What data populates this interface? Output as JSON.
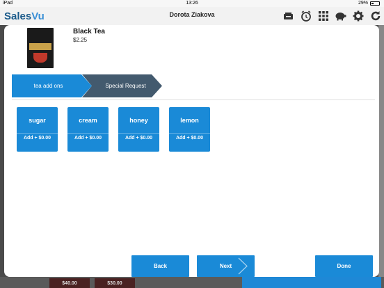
{
  "status": {
    "device": "iPad",
    "time": "13:26",
    "battery": "29%"
  },
  "header": {
    "logo_sales": "Sales",
    "logo_vu": "Vu",
    "user": "Dorota Ziakova",
    "icons": [
      "register-icon",
      "alarm-clock-icon",
      "grid-icon",
      "piggy-bank-icon",
      "gear-icon",
      "refresh-icon"
    ]
  },
  "product": {
    "name": "Black Tea",
    "price": "$2.25"
  },
  "steps": [
    {
      "label": "tea add ons",
      "active": true
    },
    {
      "label": "Special Request",
      "active": false
    }
  ],
  "addons": [
    {
      "name": "sugar",
      "price": "Add + $0.00"
    },
    {
      "name": "cream",
      "price": "Add + $0.00"
    },
    {
      "name": "honey",
      "price": "Add + $0.00"
    },
    {
      "name": "lemon",
      "price": "Add + $0.00"
    }
  ],
  "background": {
    "price_1": "$40.00",
    "price_2": "$30.00"
  },
  "buttons": {
    "back": "Back",
    "next": "Next",
    "done": "Done"
  },
  "colors": {
    "accent": "#1a8ad7",
    "step_inactive": "#435a6e"
  }
}
